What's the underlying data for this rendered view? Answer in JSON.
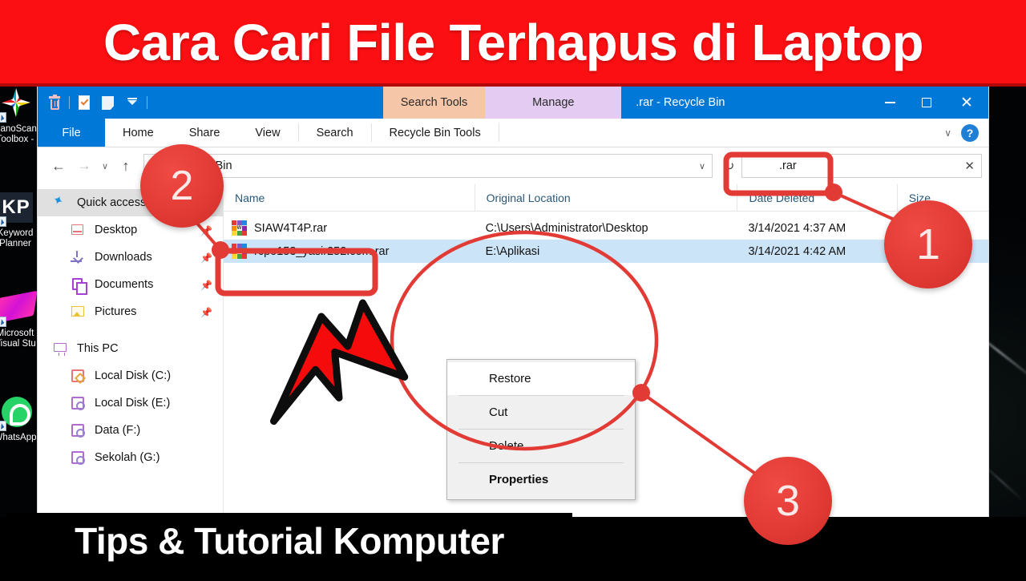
{
  "banners": {
    "top_title": "Cara Cari File Terhapus di Laptop",
    "bottom_title": "Tips & Tutorial Komputer",
    "top_bg": "#fb0f12",
    "bottom_bg": "#000000"
  },
  "desktop": {
    "shortcuts": [
      {
        "name": "nanoscan-toolbox",
        "label": "NanoScan\nToolbox -"
      },
      {
        "name": "keyword-planner",
        "label": "Keyword\nPlanner",
        "tile_text": "KP"
      },
      {
        "name": "microsoft-visual-studio",
        "label": "Microsoft\nVisual Stu"
      },
      {
        "name": "whatsapp",
        "label": "WhatsApp"
      }
    ]
  },
  "window": {
    "title": ".rar - Recycle Bin",
    "quick_access_toolbar": [
      {
        "name": "recycle-bin-icon",
        "tooltip": "Recycle Bin"
      },
      {
        "name": "properties-icon",
        "tooltip": "Properties"
      },
      {
        "name": "empty-recycle-bin-icon",
        "tooltip": "Empty Recycle Bin"
      },
      {
        "name": "customize-quick-access-icon",
        "tooltip": "Customize Quick Access Toolbar"
      }
    ],
    "contextual_tabs": [
      {
        "label": "Search Tools",
        "color": "#f6c6a8"
      },
      {
        "label": "Manage",
        "color": "#e3cbf2"
      }
    ],
    "controls": {
      "minimize": "–",
      "maximize": "□",
      "close": "✕"
    }
  },
  "ribbon": {
    "tabs": [
      {
        "label": "File",
        "active": true
      },
      {
        "label": "Home",
        "active": false
      },
      {
        "label": "Share",
        "active": false
      },
      {
        "label": "View",
        "active": false
      },
      {
        "label": "Search",
        "active": false
      },
      {
        "label": "Recycle Bin Tools",
        "active": false
      }
    ],
    "collapse_label": "∨",
    "help_label": "?"
  },
  "address_bar": {
    "back": "←",
    "forward": "→",
    "recent": "∨",
    "up": "↑",
    "path": "Recycle Bin",
    "path_chevron": "∨",
    "refresh": "↻"
  },
  "search": {
    "value": ".rar",
    "clear_label": "✕"
  },
  "nav_pane": {
    "items": [
      {
        "label": "Quick access",
        "icon": "star-icon",
        "level": 0,
        "selected": true,
        "pinned": false
      },
      {
        "label": "Desktop",
        "icon": "desktop-icon",
        "level": 1,
        "selected": false,
        "pinned": true
      },
      {
        "label": "Downloads",
        "icon": "download-icon",
        "level": 1,
        "selected": false,
        "pinned": true
      },
      {
        "label": "Documents",
        "icon": "documents-icon",
        "level": 1,
        "selected": false,
        "pinned": true
      },
      {
        "label": "Pictures",
        "icon": "pictures-icon",
        "level": 1,
        "selected": false,
        "pinned": true
      },
      {
        "label": "This PC",
        "icon": "this-pc-icon",
        "level": 0,
        "selected": false,
        "pinned": false
      },
      {
        "label": "Local Disk (C:)",
        "icon": "drive-c-icon",
        "level": 1,
        "selected": false,
        "pinned": false
      },
      {
        "label": "Local Disk (E:)",
        "icon": "drive-icon",
        "level": 1,
        "selected": false,
        "pinned": false
      },
      {
        "label": "Data (F:)",
        "icon": "drive-icon",
        "level": 1,
        "selected": false,
        "pinned": false
      },
      {
        "label": "Sekolah (G:)",
        "icon": "drive-icon",
        "level": 1,
        "selected": false,
        "pinned": false
      }
    ],
    "pin_glyph": "📌"
  },
  "file_list": {
    "columns": [
      "Name",
      "Original Location",
      "Date Deleted",
      "Size"
    ],
    "sort_indicator": "ⱏ",
    "rows": [
      {
        "name": "SIAW4T4P.rar",
        "location": "C:\\Users\\Administrator\\Desktop",
        "date_deleted": "3/14/2021 4:37 AM",
        "size": "",
        "selected": false
      },
      {
        "name": "rcpo153_yasir252.com.rar",
        "location": "E:\\Aplikasi",
        "date_deleted": "3/14/2021 4:42 AM",
        "size": "",
        "selected": true
      }
    ]
  },
  "context_menu": {
    "items": [
      {
        "label": "Restore",
        "bold": false,
        "highlighted": true
      },
      {
        "label": "Cut",
        "bold": false,
        "highlighted": false
      },
      {
        "label": "Delete",
        "bold": false,
        "highlighted": false
      },
      {
        "label": "Properties",
        "bold": true,
        "highlighted": false
      }
    ]
  },
  "annotations": {
    "accent_color": "#e23b35",
    "markers": [
      {
        "label": "1",
        "target": "search-box"
      },
      {
        "label": "2",
        "target": "selected-file-row"
      },
      {
        "label": "3",
        "target": "context-menu"
      }
    ],
    "shapes": [
      {
        "type": "rectangle",
        "around": "search-box"
      },
      {
        "type": "rectangle",
        "around": "selected-file-row"
      },
      {
        "type": "ellipse",
        "around": "context-menu"
      },
      {
        "type": "arrow",
        "points_at": "context-menu"
      }
    ]
  }
}
